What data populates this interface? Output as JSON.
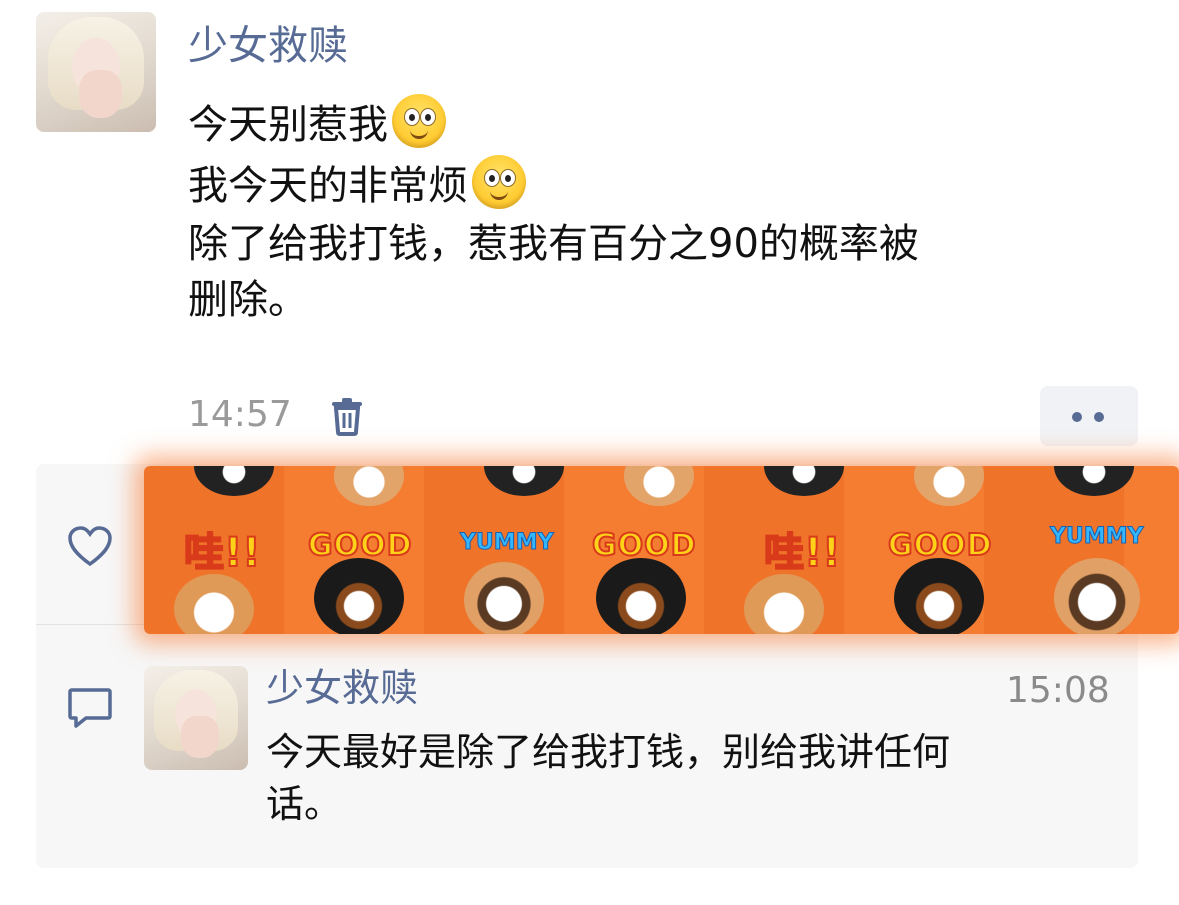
{
  "post": {
    "author": "少女救赎",
    "lines": [
      "今天别惹我",
      "我今天的非常烦",
      "除了给我打钱，惹我有百分之90的概率被",
      "删除。"
    ],
    "time": "14:57",
    "trash_icon": "trash-icon",
    "more_icon": "more-dots-icon"
  },
  "likes": {
    "icon": "heart-outline-icon",
    "sticker_words": [
      "哇!!",
      "GOOD",
      "YUMMY",
      "GOOD",
      "哇!!",
      "GOOD",
      "YUMMY"
    ]
  },
  "comments": {
    "icon": "comment-bubble-icon",
    "items": [
      {
        "author": "少女救赎",
        "time": "15:08",
        "text_line1": "今天最好是除了给我打钱，别给我讲任何",
        "text_line2": "话。"
      }
    ]
  },
  "colors": {
    "name_blue": "#576b95",
    "banner_orange": "#f0732a",
    "panel_bg": "#f7f7f7"
  }
}
